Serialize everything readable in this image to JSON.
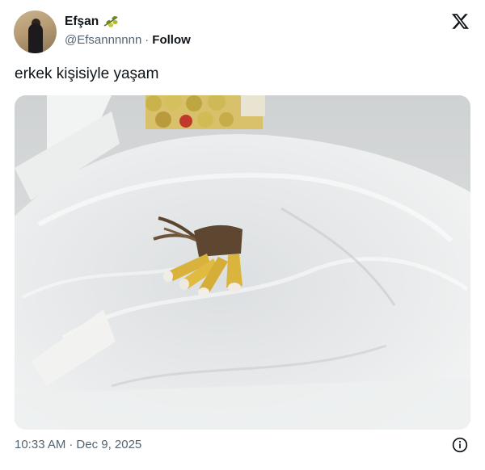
{
  "tweet": {
    "author": {
      "display_name": "Efşan",
      "handle": "@Efsannnnnn",
      "avatar_icon": "avatar-photo",
      "name_emoji": "olive-branch-emoji"
    },
    "follow_label": "Follow",
    "separator": "·",
    "text": "erkek kişisiyle yaşam",
    "time": "10:33 AM",
    "date": "Dec 9, 2025",
    "brand_icon": "x-logo-icon",
    "info_icon": "info-icon"
  },
  "colors": {
    "text_primary": "#0f1419",
    "text_secondary": "#536471",
    "background": "#ffffff"
  }
}
